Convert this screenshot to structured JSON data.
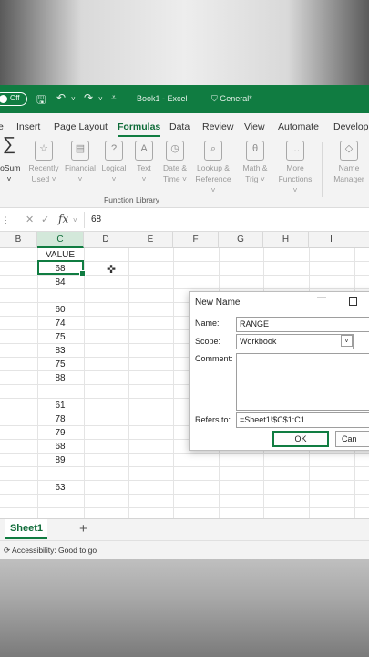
{
  "titlebar": {
    "autosave_label": "Off",
    "document_title": "Book1 - Excel",
    "sensitivity": "General*"
  },
  "ribbon_tabs": [
    "Insert",
    "Page Layout",
    "Formulas",
    "Data",
    "Review",
    "View",
    "Automate",
    "Develope"
  ],
  "active_tab": "Formulas",
  "ribbon": {
    "autosum": {
      "line1": "toSum",
      "line2": "˅"
    },
    "buttons": [
      {
        "line1": "Recently",
        "line2": "Used ˅",
        "glyph": "☆"
      },
      {
        "line1": "Financial",
        "line2": "˅",
        "glyph": "▤"
      },
      {
        "line1": "Logical",
        "line2": "˅",
        "glyph": "?"
      },
      {
        "line1": "Text",
        "line2": "˅",
        "glyph": "A"
      },
      {
        "line1": "Date &",
        "line2": "Time ˅",
        "glyph": "◷"
      },
      {
        "line1": "Lookup &",
        "line2": "Reference ˅",
        "glyph": "⌕"
      },
      {
        "line1": "Math &",
        "line2": "Trig ˅",
        "glyph": "θ"
      },
      {
        "line1": "More",
        "line2": "Functions ˅",
        "glyph": "…"
      },
      {
        "line1": "Name",
        "line2": "Manager",
        "glyph": "◇"
      }
    ],
    "group_label": "Function Library"
  },
  "formula_bar": {
    "content": "68"
  },
  "columns": [
    "B",
    "C",
    "D",
    "E",
    "F",
    "G",
    "H",
    "I"
  ],
  "grid": {
    "header": "VALUE",
    "values": [
      "68",
      "84",
      "",
      "60",
      "74",
      "75",
      "83",
      "75",
      "88",
      "",
      "61",
      "78",
      "79",
      "68",
      "89",
      "",
      "63"
    ]
  },
  "sheet_tab": "Sheet1",
  "status": "Accessibility: Good to go",
  "dialog": {
    "title": "New Name",
    "name_label": "Name:",
    "name_value": "RANGE",
    "scope_label": "Scope:",
    "scope_value": "Workbook",
    "comment_label": "Comment:",
    "refers_label": "Refers to:",
    "refers_value": "=Sheet1!$C$1:C1",
    "ok_label": "OK",
    "cancel_label": "Can"
  },
  "colors": {
    "accent": "#107c41",
    "selection_header": "#d3e8da"
  }
}
